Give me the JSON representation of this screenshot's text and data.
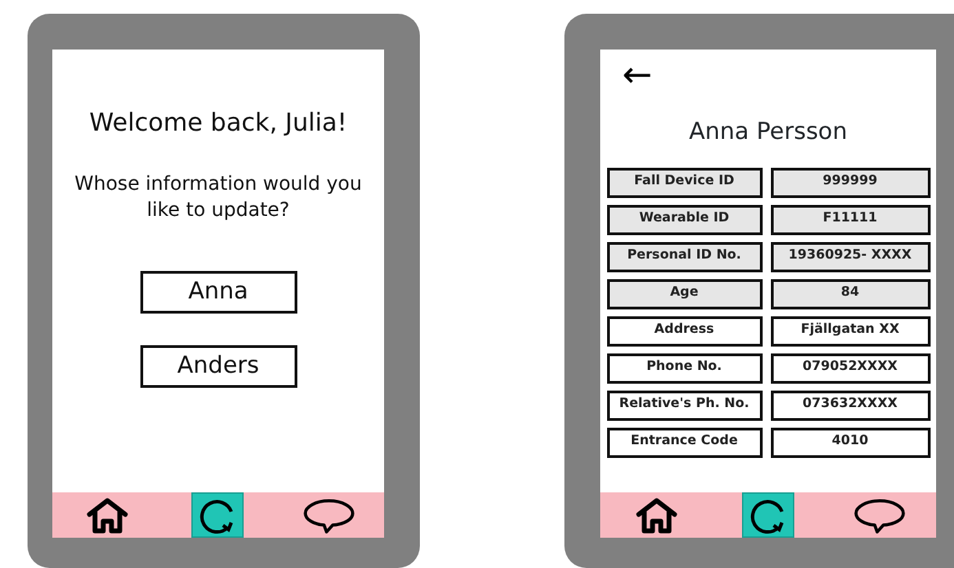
{
  "screens": [
    {
      "kind": "welcome",
      "greeting": "Welcome back, Julia!",
      "question": "Whose information would you like to update?",
      "people": [
        "Anna",
        "Anders"
      ],
      "nav": [
        {
          "kind": "home",
          "selected": false
        },
        {
          "kind": "refresh",
          "selected": true
        },
        {
          "kind": "chat",
          "selected": false
        }
      ]
    },
    {
      "kind": "details",
      "back": "←",
      "name": "Anna Persson",
      "fields": [
        {
          "label": "Fall Device ID",
          "value": "999999",
          "shaded": true
        },
        {
          "label": "Wearable ID",
          "value": "F11111",
          "shaded": true
        },
        {
          "label": "Personal ID No.",
          "value": "19360925- XXXX",
          "shaded": true
        },
        {
          "label": "Age",
          "value": "84",
          "shaded": true
        },
        {
          "label": "Address",
          "value": "Fjällgatan XX",
          "shaded": false
        },
        {
          "label": "Phone No.",
          "value": "079052XXXX",
          "shaded": false
        },
        {
          "label": "Relative's Ph. No.",
          "value": "073632XXXX",
          "shaded": false
        },
        {
          "label": "Entrance Code",
          "value": "4010",
          "shaded": false
        }
      ],
      "nav": [
        {
          "kind": "home",
          "selected": false
        },
        {
          "kind": "refresh",
          "selected": true
        },
        {
          "kind": "chat",
          "selected": false
        }
      ]
    }
  ]
}
